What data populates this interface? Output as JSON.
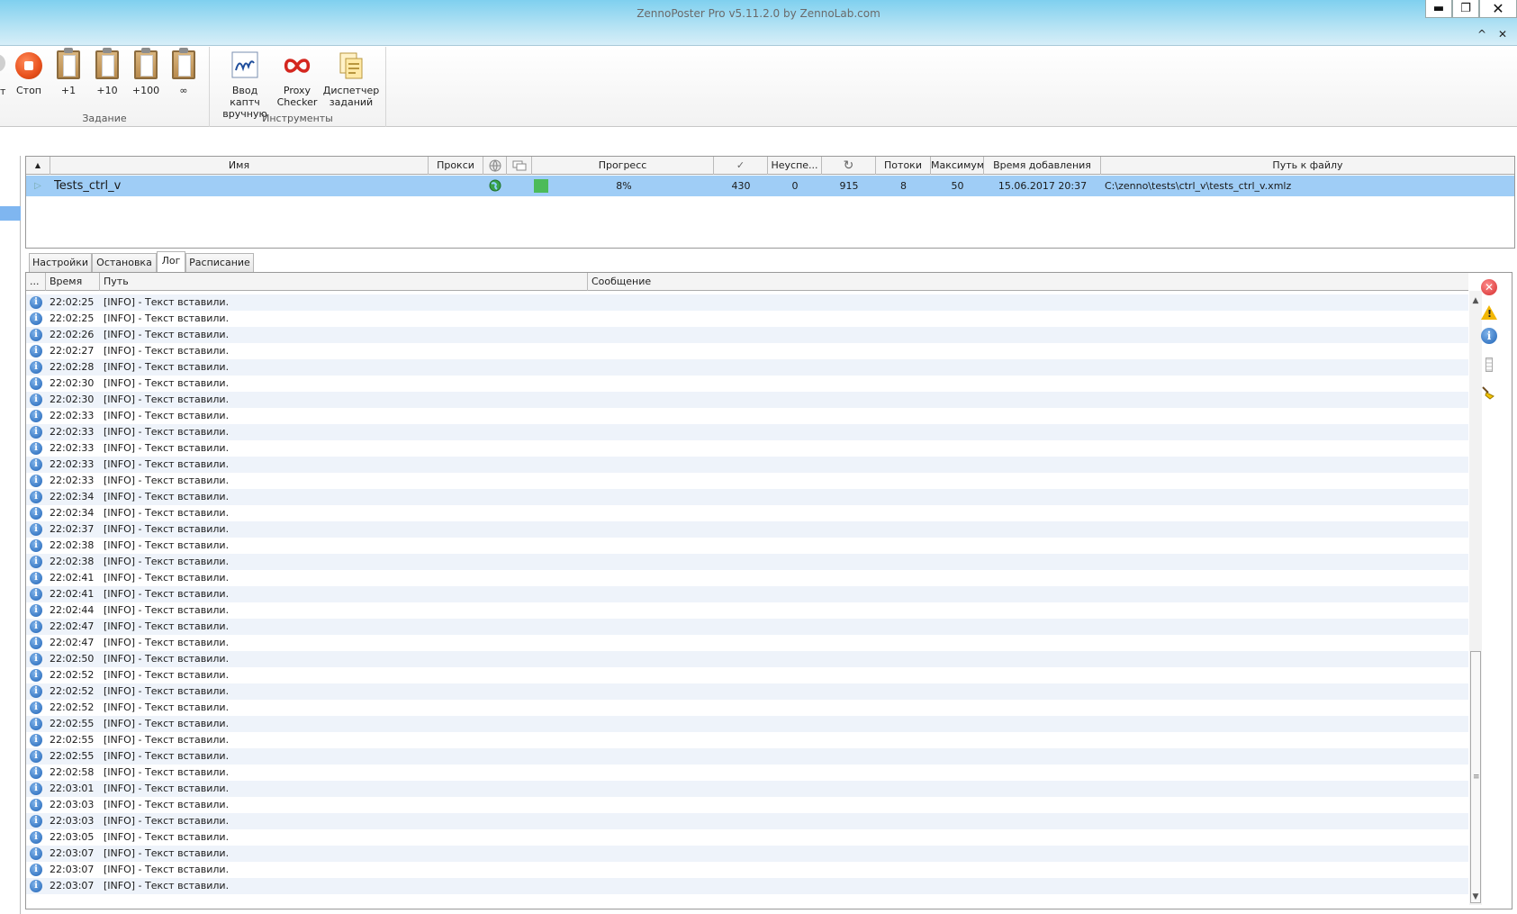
{
  "window": {
    "title": "ZennoPoster Pro v5.11.2.0 by ZennoLab.com",
    "min_glyph": "▬",
    "max_glyph": "❐",
    "close_glyph": "✕",
    "mdi_up_glyph": "^",
    "mdi_close_glyph": "✕"
  },
  "ribbon": {
    "partial_label": "т",
    "task_group": {
      "label": "Задание",
      "buttons": [
        {
          "label": "Стоп",
          "icon": "stop-icon"
        },
        {
          "label": "+1",
          "icon": "clipboard-icon"
        },
        {
          "label": "+10",
          "icon": "clipboard-icon"
        },
        {
          "label": "+100",
          "icon": "clipboard-icon"
        },
        {
          "label": "∞",
          "icon": "clipboard-icon"
        }
      ]
    },
    "tools_group": {
      "label": "Инструменты",
      "buttons": [
        {
          "label": "Ввод каптч вручную",
          "icon": "captcha-icon"
        },
        {
          "label": "Proxy Checker",
          "icon": "proxy-checker-icon"
        },
        {
          "label": "Диспетчер заданий",
          "icon": "task-manager-icon"
        }
      ]
    }
  },
  "task_grid": {
    "sort_glyph": "▲",
    "columns": [
      "Имя",
      "Прокси",
      "",
      "",
      "Прогресс",
      "✓",
      "Неуспе...",
      "↻",
      "Потоки",
      "Максимум",
      "Время добавления",
      "Путь к файлу"
    ],
    "row": {
      "name": "Tests_ctrl_v",
      "progress": "8%",
      "progress_fraction": 0.08,
      "success": "430",
      "failed": "0",
      "repeats": "915",
      "threads": "8",
      "maximum": "50",
      "added": "15.06.2017 20:37",
      "path": "C:\\zenno\\tests\\ctrl_v\\tests_ctrl_v.xmlz"
    }
  },
  "tabs": [
    "Настройки",
    "Остановка",
    "Лог",
    "Расписание"
  ],
  "active_tab": "Лог",
  "log": {
    "columns": {
      "dots": "...",
      "time": "Время",
      "path": "Путь",
      "message": "Сообщение"
    },
    "rows": [
      {
        "time": "22:02:25",
        "msg": "[INFO] - Текст вставили."
      },
      {
        "time": "22:02:25",
        "msg": "[INFO] - Текст вставили."
      },
      {
        "time": "22:02:26",
        "msg": "[INFO] - Текст вставили."
      },
      {
        "time": "22:02:27",
        "msg": "[INFO] - Текст вставили."
      },
      {
        "time": "22:02:28",
        "msg": "[INFO] - Текст вставили."
      },
      {
        "time": "22:02:30",
        "msg": "[INFO] - Текст вставили."
      },
      {
        "time": "22:02:30",
        "msg": "[INFO] - Текст вставили."
      },
      {
        "time": "22:02:33",
        "msg": "[INFO] - Текст вставили."
      },
      {
        "time": "22:02:33",
        "msg": "[INFO] - Текст вставили."
      },
      {
        "time": "22:02:33",
        "msg": "[INFO] - Текст вставили."
      },
      {
        "time": "22:02:33",
        "msg": "[INFO] - Текст вставили."
      },
      {
        "time": "22:02:33",
        "msg": "[INFO] - Текст вставили."
      },
      {
        "time": "22:02:34",
        "msg": "[INFO] - Текст вставили."
      },
      {
        "time": "22:02:34",
        "msg": "[INFO] - Текст вставили."
      },
      {
        "time": "22:02:37",
        "msg": "[INFO] - Текст вставили."
      },
      {
        "time": "22:02:38",
        "msg": "[INFO] - Текст вставили."
      },
      {
        "time": "22:02:38",
        "msg": "[INFO] - Текст вставили."
      },
      {
        "time": "22:02:41",
        "msg": "[INFO] - Текст вставили."
      },
      {
        "time": "22:02:41",
        "msg": "[INFO] - Текст вставили."
      },
      {
        "time": "22:02:44",
        "msg": "[INFO] - Текст вставили."
      },
      {
        "time": "22:02:47",
        "msg": "[INFO] - Текст вставили."
      },
      {
        "time": "22:02:47",
        "msg": "[INFO] - Текст вставили."
      },
      {
        "time": "22:02:50",
        "msg": "[INFO] - Текст вставили."
      },
      {
        "time": "22:02:52",
        "msg": "[INFO] - Текст вставили."
      },
      {
        "time": "22:02:52",
        "msg": "[INFO] - Текст вставили."
      },
      {
        "time": "22:02:52",
        "msg": "[INFO] - Текст вставили."
      },
      {
        "time": "22:02:55",
        "msg": "[INFO] - Текст вставили."
      },
      {
        "time": "22:02:55",
        "msg": "[INFO] - Текст вставили."
      },
      {
        "time": "22:02:55",
        "msg": "[INFO] - Текст вставили."
      },
      {
        "time": "22:02:58",
        "msg": "[INFO] - Текст вставили."
      },
      {
        "time": "22:03:01",
        "msg": "[INFO] - Текст вставили."
      },
      {
        "time": "22:03:03",
        "msg": "[INFO] - Текст вставили."
      },
      {
        "time": "22:03:03",
        "msg": "[INFO] - Текст вставили."
      },
      {
        "time": "22:03:05",
        "msg": "[INFO] - Текст вставили."
      },
      {
        "time": "22:03:07",
        "msg": "[INFO] - Текст вставили."
      },
      {
        "time": "22:03:07",
        "msg": "[INFO] - Текст вставили."
      },
      {
        "time": "22:03:07",
        "msg": "[INFO] - Текст вставили."
      }
    ]
  },
  "side_tools": [
    "error-filter-icon",
    "warning-filter-icon",
    "info-filter-icon",
    "debug-filter-icon",
    "clear-log-icon"
  ],
  "colors": {
    "selection": "#9fcdf6",
    "progress_green": "#4cbb5a",
    "stop_orange": "#e8501c",
    "info_blue": "#1f63b6"
  }
}
